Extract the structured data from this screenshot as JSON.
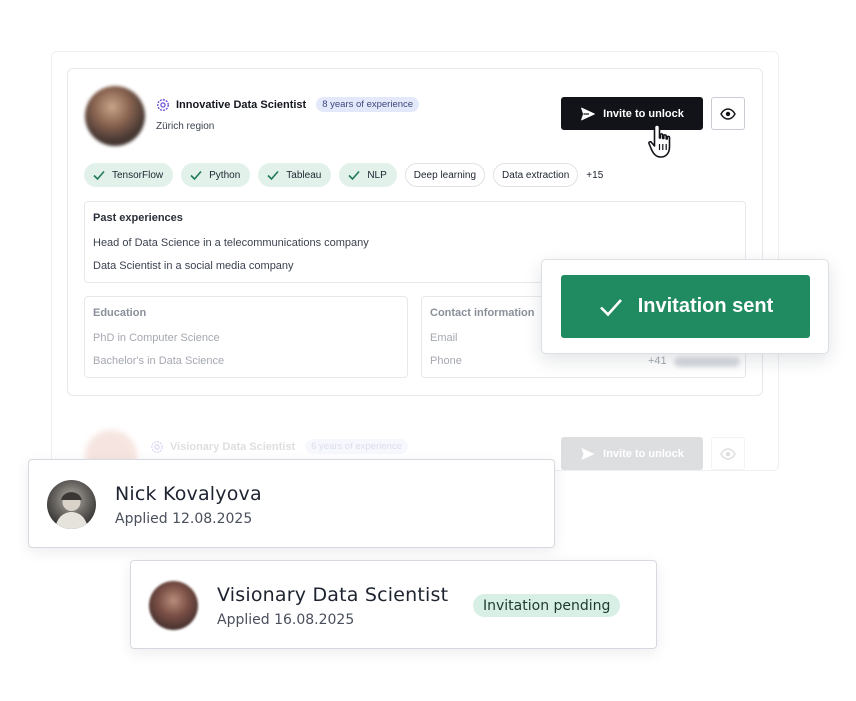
{
  "colors": {
    "accent_green": "#208a60",
    "dark_button": "#111318",
    "skill_match_bg": "#e2f1ea",
    "experience_badge_bg": "#e3e8fb",
    "pending_bg": "#d7efe4"
  },
  "profile": {
    "role_title": "Innovative Data Scientist",
    "experience_badge": "8 years of experience",
    "region": "Zürich region",
    "invite_label": "Invite to unlock",
    "skills_matched": [
      "TensorFlow",
      "Python",
      "Tableau",
      "NLP"
    ],
    "skills_other": [
      "Deep learning",
      "Data extraction"
    ],
    "more_skills": "+15",
    "past_experiences": {
      "title": "Past experiences",
      "items": [
        "Head of Data Science in a telecommunications company",
        "Data Scientist in a social media company"
      ]
    },
    "education": {
      "title": "Education",
      "items": [
        "PhD in Computer Science",
        "Bachelor's in Data Science"
      ]
    },
    "contact": {
      "title": "Contact information",
      "email_label": "Email",
      "phone_label": "Phone",
      "phone_prefix": "+41"
    }
  },
  "ghost_profile": {
    "role_title": "Visionary Data Scientist",
    "experience_badge": "6 years of experience",
    "invite_label": "Invite to unlock"
  },
  "toast": {
    "message": "Invitation sent"
  },
  "applicants": [
    {
      "name": "Nick Kovalyova",
      "applied": "Applied 12.08.2025"
    },
    {
      "name": "Visionary Data Scientist",
      "applied": "Applied 16.08.2025",
      "status": "Invitation pending"
    }
  ],
  "icons": [
    "ai-gear-icon",
    "send-icon",
    "eye-icon",
    "hand-cursor-icon",
    "check-icon"
  ]
}
